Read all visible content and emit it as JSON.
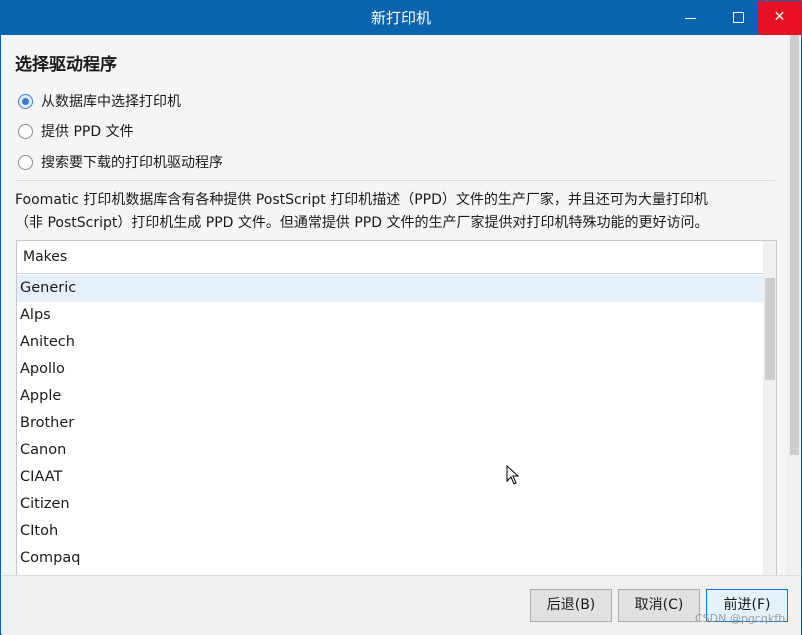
{
  "window": {
    "title": "新打印机",
    "minimize_icon": "minimize-icon",
    "maximize_icon": "maximize-icon",
    "close_icon": "close-icon",
    "close_glyph": "✕"
  },
  "main": {
    "heading": "选择驱动程序",
    "options": [
      {
        "label": "从数据库中选择打印机",
        "checked": true
      },
      {
        "label": "提供 PPD 文件",
        "checked": false
      },
      {
        "label": "搜索要下载的打印机驱动程序",
        "checked": false
      }
    ],
    "description_line1": "Foomatic 打印机数据库含有各种提供 PostScript 打印机描述（PPD）文件的生产厂家，并且还可为大量打印机",
    "description_line2": "（非 PostScript）打印机生成 PPD 文件。但通常提供 PPD 文件的生产厂家提供对打印机特殊功能的更好访问。"
  },
  "makes_list": {
    "header": "Makes",
    "selected_index": 0,
    "rows": [
      "Generic",
      "Alps",
      "Anitech",
      "Apollo",
      "Apple",
      "Brother",
      "Canon",
      "CIAAT",
      "Citizen",
      "CItoh",
      "Compaq"
    ]
  },
  "footer": {
    "back_label": "后退(B)",
    "cancel_label": "取消(C)",
    "next_label": "前进(F)"
  },
  "watermark": "CSDN @pgcqkfb",
  "colors": {
    "titlebar": "#0a64ad",
    "close_hover": "#e81123",
    "selection": "#e5f0fb",
    "radio_accent": "#3a7bd5"
  }
}
